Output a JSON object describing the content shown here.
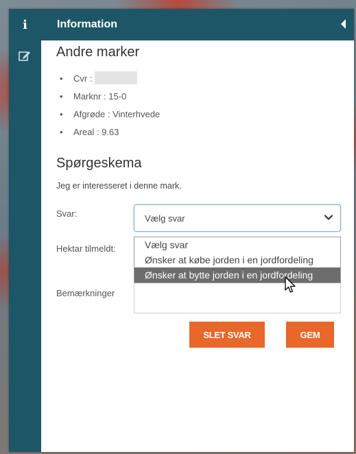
{
  "header": {
    "title": "Information",
    "icon": "info-icon",
    "collapse_icon": "triangle-left-icon"
  },
  "sidebar": {
    "items": [
      {
        "icon": "edit-icon"
      }
    ]
  },
  "section1": {
    "title": "Andre marker",
    "details": [
      {
        "label": "Cvr :",
        "value": ""
      },
      {
        "label": "Marknr : 15-0"
      },
      {
        "label": "Afgrøde : Vinterhvede"
      },
      {
        "label": "Areal : 9.63"
      }
    ]
  },
  "section2": {
    "title": "Spørgeskema",
    "intro": "Jeg er interesseret i denne mark.",
    "svar_label": "Svar:",
    "select_value": "Vælg svar",
    "options": [
      "Vælg svar",
      "Ønsker at købe jorden i en jordfordeling",
      "Ønsker at bytte jorden i en jordfordeling"
    ],
    "selected_option_index": 2,
    "hektar_label": "Hektar tilmeldt:",
    "bemaerk_label": "Bemærkninger",
    "delete_button": "SLET SVAR",
    "save_button": "GEM"
  },
  "colors": {
    "header": "#1d5666",
    "accent_button": "#e8672a",
    "highlight": "#6d6d6d"
  }
}
